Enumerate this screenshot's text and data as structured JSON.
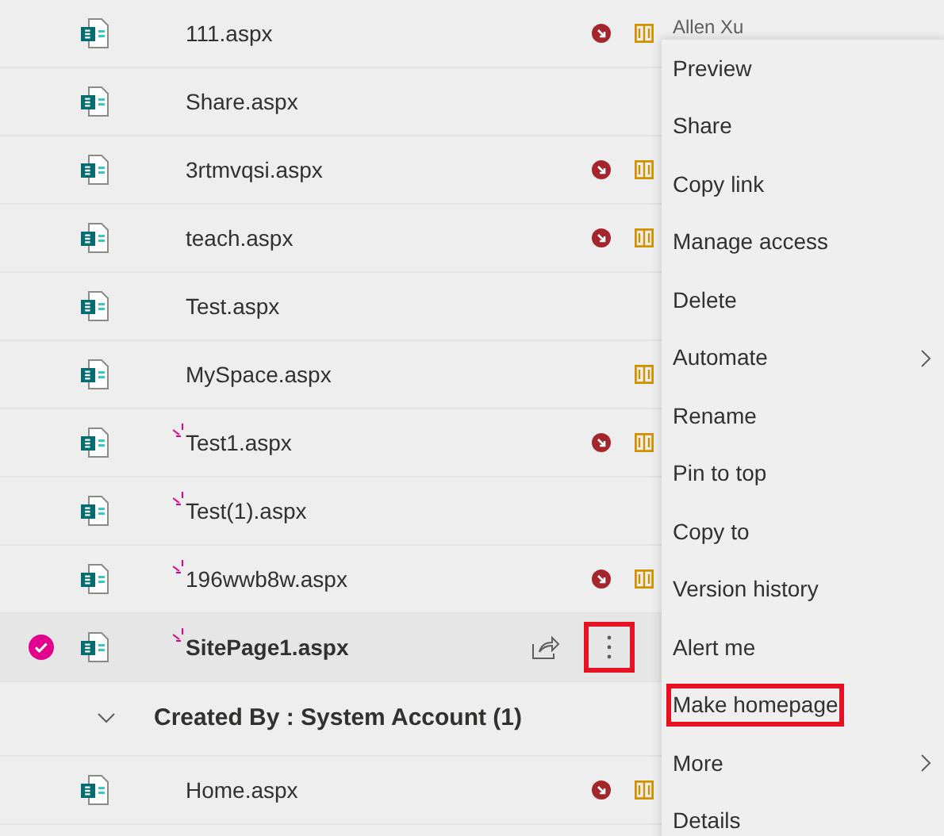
{
  "rows": [
    {
      "name": "111.aspx",
      "new": false,
      "checked_out": true,
      "published_pending": true,
      "author": "Allen Xu",
      "selected": false
    },
    {
      "name": "Share.aspx",
      "new": false,
      "checked_out": false,
      "published_pending": false,
      "selected": false
    },
    {
      "name": "3rtmvqsi.aspx",
      "new": false,
      "checked_out": true,
      "published_pending": true,
      "selected": false
    },
    {
      "name": "teach.aspx",
      "new": false,
      "checked_out": true,
      "published_pending": true,
      "selected": false
    },
    {
      "name": "Test.aspx",
      "new": false,
      "checked_out": false,
      "published_pending": false,
      "selected": false
    },
    {
      "name": "MySpace.aspx",
      "new": false,
      "checked_out": false,
      "published_pending": true,
      "selected": false
    },
    {
      "name": "Test1.aspx",
      "new": true,
      "checked_out": true,
      "published_pending": true,
      "selected": false
    },
    {
      "name": "Test(1).aspx",
      "new": true,
      "checked_out": false,
      "published_pending": false,
      "selected": false
    },
    {
      "name": "196wwb8w.aspx",
      "new": true,
      "checked_out": true,
      "published_pending": true,
      "selected": false
    },
    {
      "name": "SitePage1.aspx",
      "new": true,
      "checked_out": false,
      "published_pending": false,
      "selected": true,
      "more_highlighted": true
    }
  ],
  "group": {
    "label": "Created By : System Account (1)",
    "expanded": true,
    "rows": [
      {
        "name": "Home.aspx",
        "new": false,
        "checked_out": true,
        "published_pending": true,
        "selected": false
      }
    ]
  },
  "context_menu": [
    {
      "label": "Preview",
      "submenu": false,
      "highlighted": false
    },
    {
      "label": "Share",
      "submenu": false,
      "highlighted": false
    },
    {
      "label": "Copy link",
      "submenu": false,
      "highlighted": false
    },
    {
      "label": "Manage access",
      "submenu": false,
      "highlighted": false
    },
    {
      "label": "Delete",
      "submenu": false,
      "highlighted": false
    },
    {
      "label": "Automate",
      "submenu": true,
      "highlighted": false
    },
    {
      "label": "Rename",
      "submenu": false,
      "highlighted": false
    },
    {
      "label": "Pin to top",
      "submenu": false,
      "highlighted": false
    },
    {
      "label": "Copy to",
      "submenu": false,
      "highlighted": false
    },
    {
      "label": "Version history",
      "submenu": false,
      "highlighted": false
    },
    {
      "label": "Alert me",
      "submenu": false,
      "highlighted": false
    },
    {
      "label": "Make homepage",
      "submenu": false,
      "highlighted": true
    },
    {
      "label": "More",
      "submenu": true,
      "highlighted": false
    },
    {
      "label": "Details",
      "submenu": false,
      "highlighted": false
    }
  ]
}
